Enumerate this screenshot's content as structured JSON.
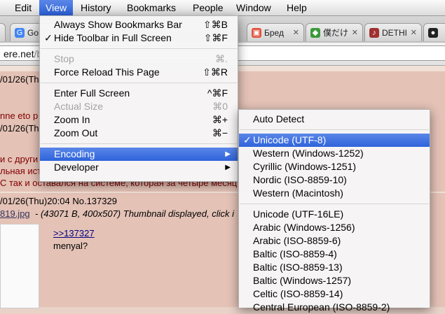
{
  "menubar": [
    "Edit",
    "View",
    "History",
    "Bookmarks",
    "People",
    "Window",
    "Help"
  ],
  "tabs": [
    {
      "title": "Go",
      "icon": "google-icon",
      "color": "#4285f4"
    },
    {
      "title": "Бред",
      "icon": "gift-icon",
      "color": "#e0533b"
    },
    {
      "title": "僕だけ",
      "icon": "space-invader-icon",
      "color": "#3a9a3a"
    },
    {
      "title": "DETHI",
      "icon": "guitar-icon",
      "color": "#a03030"
    },
    {
      "title": "",
      "icon": "github-icon",
      "color": "#222222"
    }
  ],
  "address": {
    "host": "ere.net",
    "path": "/b"
  },
  "page": {
    "post1_header": "/01/26(Th",
    "line_a": "nne eto p",
    "post2_header": "/01/26(Th",
    "line_b": "и с други",
    "line_c": "льная ист",
    "line_d": "С так и оставался на системе, которая за четыре месяц",
    "post3_header": "/01/26(Thu)20:04 No.137329",
    "file_link": "819.jpg",
    "file_info": "- (43071 B, 400x507) Thumbnail displayed, click i",
    "reply_link": ">>137327",
    "reply_text": "menyal?"
  },
  "view_menu": [
    {
      "label": "Always Show Bookmarks Bar",
      "shortcut": "⇧⌘B",
      "checked": false,
      "disabled": false
    },
    {
      "label": "Hide Toolbar in Full Screen",
      "shortcut": "⇧⌘F",
      "checked": true,
      "disabled": false
    },
    {
      "sep": true
    },
    {
      "label": "Stop",
      "shortcut": "⌘.",
      "checked": false,
      "disabled": true
    },
    {
      "label": "Force Reload This Page",
      "shortcut": "⇧⌘R",
      "checked": false,
      "disabled": false
    },
    {
      "sep": true
    },
    {
      "label": "Enter Full Screen",
      "shortcut": "^⌘F",
      "checked": false,
      "disabled": false
    },
    {
      "label": "Actual Size",
      "shortcut": "⌘0",
      "checked": false,
      "disabled": true
    },
    {
      "label": "Zoom In",
      "shortcut": "⌘+",
      "checked": false,
      "disabled": false
    },
    {
      "label": "Zoom Out",
      "shortcut": "⌘−",
      "checked": false,
      "disabled": false
    },
    {
      "sep": true
    },
    {
      "label": "Encoding",
      "submenu": true,
      "highlighted": true
    },
    {
      "label": "Developer",
      "submenu": true
    }
  ],
  "encoding_menu": [
    {
      "label": "Auto Detect",
      "checked": false
    },
    {
      "sep": true
    },
    {
      "label": "Unicode (UTF-8)",
      "checked": true,
      "highlighted": true
    },
    {
      "label": "Western (Windows-1252)"
    },
    {
      "label": "Cyrillic (Windows-1251)"
    },
    {
      "label": "Nordic (ISO-8859-10)"
    },
    {
      "label": "Western (Macintosh)"
    },
    {
      "sep": true
    },
    {
      "label": "Unicode (UTF-16LE)"
    },
    {
      "label": "Arabic (Windows-1256)"
    },
    {
      "label": "Arabic (ISO-8859-6)"
    },
    {
      "label": "Baltic (ISO-8859-4)"
    },
    {
      "label": "Baltic (ISO-8859-13)"
    },
    {
      "label": "Baltic (Windows-1257)"
    },
    {
      "label": "Celtic (ISO-8859-14)"
    },
    {
      "label": "Central European (ISO-8859-2)"
    }
  ]
}
